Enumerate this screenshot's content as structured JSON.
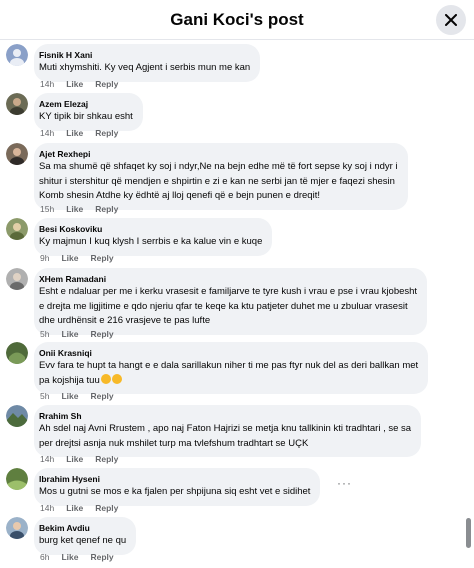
{
  "header": {
    "title": "Gani Koci's post"
  },
  "comments": [
    {
      "author": "Fisnik H Xani",
      "text": "Muti xhymshiti. Ky veq Agjent i serbis mun me kan",
      "time": "14h",
      "like": "Like",
      "reply": "Reply"
    },
    {
      "author": "Azem Elezaj",
      "text": "KY tipik bir shkau esht",
      "time": "14h",
      "like": "Like",
      "reply": "Reply"
    },
    {
      "author": "Ajet Rexhepi",
      "text_lines": [
        "Sa ma shumë që shfaqet ky soj i ndyr,Ne na bejn edhe më të fort sepse ky soj i ndyr i",
        "shitur i stershitur që mendjen e shpirtin e zi e kan ne serbi jan të mjer e faqezi shesin",
        "Komb shesin Atdhe ky ëdhtë aj lloj qenefi që e bejn punen e dreqit!"
      ],
      "time": "15h",
      "like": "Like",
      "reply": "Reply"
    },
    {
      "author": "Besi Koskoviku",
      "text": "Ky majmun I kuq klysh I serrbis e ka kalue vin e kuqe",
      "time": "9h",
      "like": "Like",
      "reply": "Reply"
    },
    {
      "author": "XHem Ramadani",
      "text_lines": [
        "Esht e ndaluar per me i kerku vrasesit e familjarve te tyre kush i vrau e pse i vrau kjobesht",
        "e drejta me ligjitime e qdo njeriu qfar te keqe ka ktu patjeter duhet me u zbuluar vrasesit",
        "dhe urdhënsit e 216 vrasjeve te pas lufte"
      ],
      "time": "5h",
      "like": "Like",
      "reply": "Reply"
    },
    {
      "author": "Onii Krasniqi",
      "text_lines": [
        "Evv fara te hupt ta hangt e e dala sarillakun niher ti me pas ftyr nuk del as deri ballkan met",
        "pa kojshija tuu"
      ],
      "time": "5h",
      "like": "Like",
      "reply": "Reply"
    },
    {
      "author": "Rrahim Sh",
      "text_lines": [
        "Ah sdel naj Avni Rrustem , apo naj Faton Hajrizi se metja knu tallkinin kti tradhtari , se sa",
        "per drejtsi asnja nuk mshilet turp ma tvlefshum tradhtart se UÇK"
      ],
      "time": "14h",
      "like": "Like",
      "reply": "Reply"
    },
    {
      "author": "Ibrahim Hyseni",
      "text": "Mos u gutni se mos e ka fjalen per shpijuna siq esht vet e sidihet",
      "time": "14h",
      "like": "Like",
      "reply": "Reply",
      "more": "···"
    },
    {
      "author": "Bekim Avdiu",
      "text": "burg ket qenef ne qu",
      "time": "6h",
      "like": "Like",
      "reply": "Reply"
    }
  ],
  "colors": {
    "bubble": "#f0f2f5",
    "meta": "#65676b",
    "emoji": "#f7b928"
  },
  "icons": {
    "close": "close-icon",
    "avatar": "avatar"
  }
}
